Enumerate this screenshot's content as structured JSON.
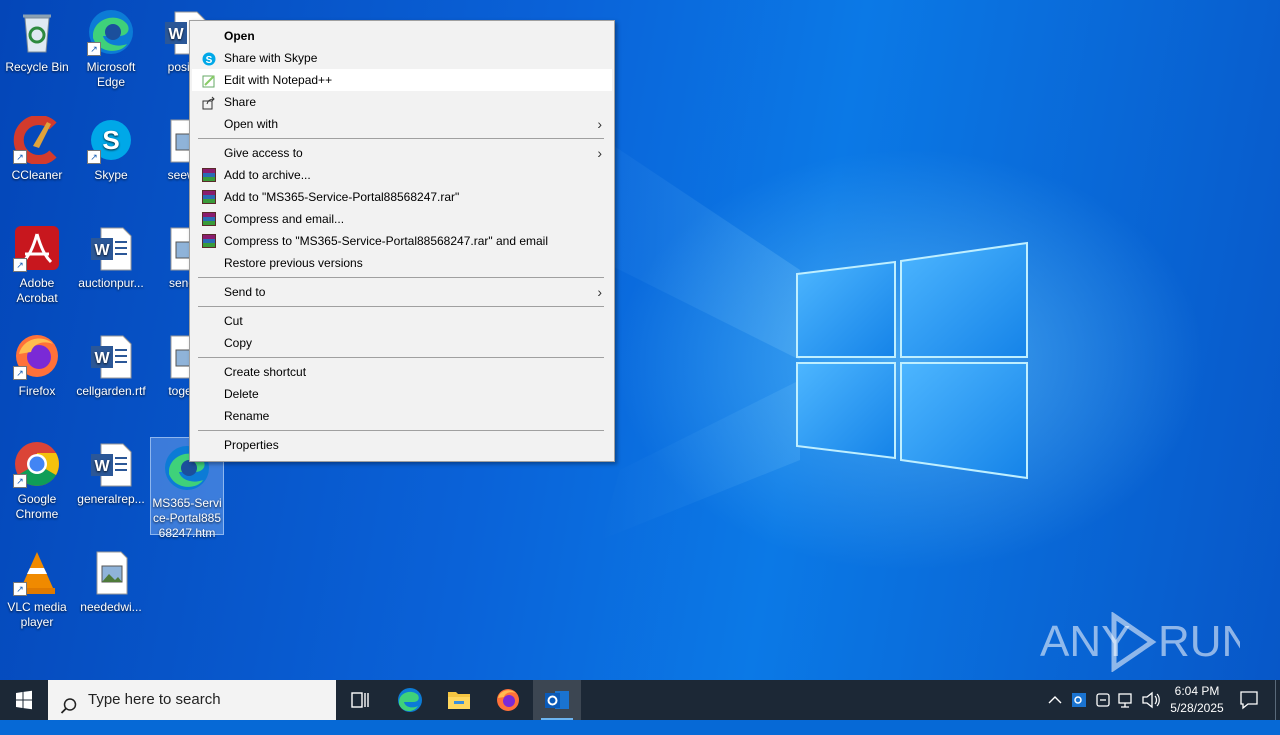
{
  "desktop_icons": [
    {
      "label": "Recycle Bin",
      "icon": "recycle-bin-icon"
    },
    {
      "label": "Microsoft Edge",
      "icon": "edge-icon"
    },
    {
      "label": "positio",
      "icon": "word-doc-icon"
    },
    {
      "label": "CCleaner",
      "icon": "ccleaner-icon"
    },
    {
      "label": "Skype",
      "icon": "skype-icon"
    },
    {
      "label": "seewo",
      "icon": "image-file-icon"
    },
    {
      "label": "Adobe Acrobat",
      "icon": "acrobat-icon"
    },
    {
      "label": "auctionpur...",
      "icon": "word-doc-icon"
    },
    {
      "label": "sendc",
      "icon": "image-file-icon"
    },
    {
      "label": "Firefox",
      "icon": "firefox-icon"
    },
    {
      "label": "cellgarden.rtf",
      "icon": "word-doc-icon"
    },
    {
      "label": "togeth",
      "icon": "image-file-icon"
    },
    {
      "label": "Google Chrome",
      "icon": "chrome-icon"
    },
    {
      "label": "generalrep...",
      "icon": "word-doc-icon"
    },
    {
      "label": "MS365-Service-Portal88568247.htm",
      "icon": "edge-html-file-icon"
    },
    {
      "label": "VLC media player",
      "icon": "vlc-icon"
    },
    {
      "label": "neededwi...",
      "icon": "image-file-icon"
    }
  ],
  "context_menu": {
    "items": [
      {
        "label": "Open"
      },
      {
        "label": "Share with Skype"
      },
      {
        "label": "Edit with Notepad++"
      },
      {
        "label": "Share"
      },
      {
        "label": "Open with"
      },
      {
        "label": "Give access to"
      },
      {
        "label": "Add to archive..."
      },
      {
        "label": "Add to \"MS365-Service-Portal88568247.rar\""
      },
      {
        "label": "Compress and email..."
      },
      {
        "label": "Compress to \"MS365-Service-Portal88568247.rar\" and email"
      },
      {
        "label": "Restore previous versions"
      },
      {
        "label": "Send to"
      },
      {
        "label": "Cut"
      },
      {
        "label": "Copy"
      },
      {
        "label": "Create shortcut"
      },
      {
        "label": "Delete"
      },
      {
        "label": "Rename"
      },
      {
        "label": "Properties"
      }
    ]
  },
  "taskbar": {
    "search_placeholder": "Type here to search",
    "time": "6:04 PM",
    "date": "5/28/2025",
    "apps": [
      "task-view-icon",
      "edge-icon",
      "file-explorer-icon",
      "firefox-icon",
      "outlook-icon"
    ]
  },
  "watermark": {
    "text_left": "ANY",
    "text_right": "RUN"
  },
  "colors": {
    "accent": "#0669d6",
    "taskbar": "#1c2836",
    "menu_bg": "#f2f2f2"
  }
}
